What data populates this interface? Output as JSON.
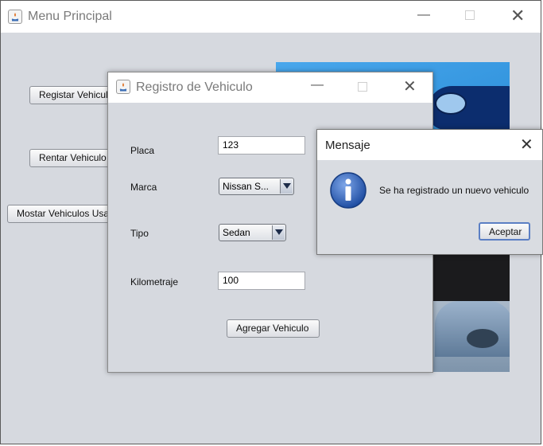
{
  "main_window": {
    "title": "Menu Principal",
    "buttons": {
      "register": "Registar Vehiculo",
      "rent": "Rentar Vehiculo",
      "show_used": "Mostar Vehiculos Usados"
    }
  },
  "register_dialog": {
    "title": "Registro de Vehiculo",
    "fields": {
      "placa_label": "Placa",
      "placa_value": "123",
      "marca_label": "Marca",
      "marca_value": "Nissan S...",
      "tipo_label": "Tipo",
      "tipo_value": "Sedan",
      "kilometraje_label": "Kilometraje",
      "kilometraje_value": "100"
    },
    "add_button": "Agregar Vehiculo"
  },
  "message_dialog": {
    "title": "Mensaje",
    "message": "Se ha registrado un nuevo vehiculo",
    "accept_button": "Aceptar",
    "icon": "info-icon"
  },
  "colors": {
    "window_bg": "#d6d9df",
    "info_blue": "#2e5fb5",
    "accent_button_border": "#5b7fc4"
  }
}
